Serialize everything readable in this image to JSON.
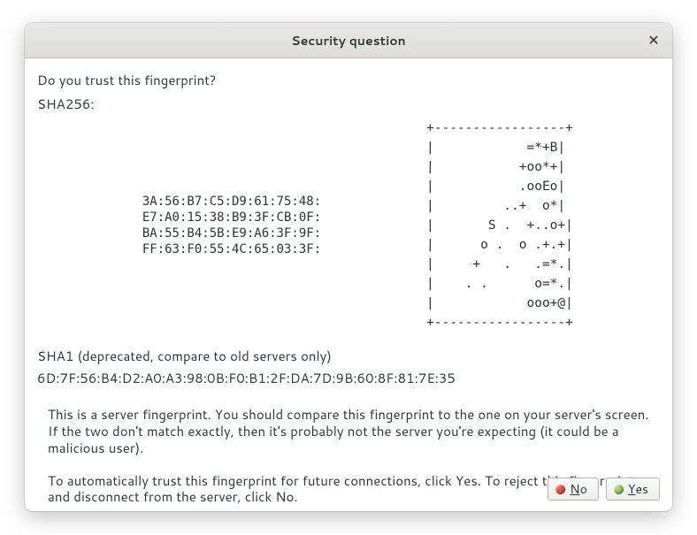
{
  "titlebar": {
    "title": "Security question",
    "close_glyph": "✕"
  },
  "prompt": "Do you trust this fingerprint?",
  "sha256_label": "SHA256:",
  "sha256_hex": "3A:56:B7:C5:D9:61:75:48:\nE7:A0:15:38:B9:3F:CB:0F:\nBA:55:B4:5B:E9:A6:3F:9F:\nFF:63:F0:55:4C:65:03:3F:",
  "randomart": "+-----------------+\n|            =*+B|\n|           +oo*+|\n|           .ooEo|\n|         ..+  o*|\n|       S .  +..o+|\n|      o .  o .+.+|\n|     +   .   .=*.|\n|    . .      o=*.|\n|            ooo+@|\n+-----------------+",
  "sha1_label": "SHA1 (deprecated, compare to old servers only)",
  "sha1_value": "6D:7F:56:B4:D2:A0:A3:98:0B:F0:B1:2F:DA:7D:9B:60:8F:81:7E:35",
  "explain1": "This is a server fingerprint. You should compare this fingerprint to the one on your server's screen. If the two don't match exactly, then it's probably not the server you're expecting (it could be a malicious user).",
  "explain2": "To automatically trust this fingerprint for future connections, click Yes. To reject this fingerprint and disconnect from the server, click No.",
  "buttons": {
    "no_prefix": "N",
    "no_rest": "o",
    "yes_prefix": "Y",
    "yes_rest": "es"
  }
}
